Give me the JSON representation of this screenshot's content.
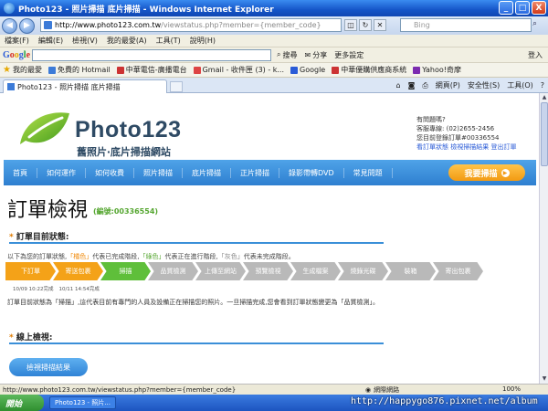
{
  "window": {
    "title": "Photo123 - 照片掃描 底片掃描 - Windows Internet Explorer",
    "minimize": "_",
    "maximize": "□",
    "close": "X"
  },
  "address": {
    "url_host": "http://www.photo123.com.tw",
    "url_path": "/viewstatus.php?member={member_code}",
    "search_placeholder": "Bing",
    "back": "◀",
    "forward": "▶"
  },
  "menu": [
    "檔案(F)",
    "編輯(E)",
    "檢視(V)",
    "我的最愛(A)",
    "工具(T)",
    "說明(H)"
  ],
  "google_toolbar": {
    "logo": [
      "G",
      "o",
      "o",
      "g",
      "l",
      "e"
    ],
    "search_label": "搜尋",
    "share_label": "分享",
    "more_label": "更多設定",
    "signin_label": "登入"
  },
  "favorites": {
    "label": "我的最愛",
    "items": [
      "免費的 Hotmail",
      "中華電信-廣播電台",
      "Gmail - 收件匣 (3) - k...",
      "Google",
      "中華優購供應商系統",
      "Yahoo!奇摩"
    ]
  },
  "tab": {
    "title": "Photo123 - 照片掃描 底片掃描",
    "commands": [
      "網頁(P)",
      "安全性(S)",
      "工具(O)"
    ]
  },
  "site": {
    "logo_text": "Photo123",
    "logo_sub": "舊照片‧底片掃描網站",
    "contact_lines": [
      "有問題嗎?",
      "客服專線: (02)2655-2456",
      "您目前登錄訂單#00336554"
    ],
    "contact_links": "看訂單狀態 檢視掃描結果 登出訂單",
    "nav": [
      "首頁",
      "如何運作",
      "如何收費",
      "照片掃描",
      "底片掃描",
      "正片掃描",
      "錄影帶轉DVD",
      "常見問題"
    ],
    "cta": "我要掃描"
  },
  "order": {
    "title": "訂單檢視",
    "order_number": "(編號:00336554)",
    "status_heading": "訂單目前狀態:",
    "legend_prefix": "以下為您的訂單狀態,",
    "legend_orange": "「橘色」",
    "legend_mid1": "代表已完成階段,",
    "legend_green": "「綠色」",
    "legend_mid2": "代表正在進行階段,",
    "legend_gray": "「灰色」",
    "legend_end": "代表未完成階段。",
    "steps": [
      {
        "label": "下訂單",
        "state": "done"
      },
      {
        "label": "寄送包裹",
        "state": "done"
      },
      {
        "label": "掃描",
        "state": "current"
      },
      {
        "label": "品質檢測",
        "state": "todo"
      },
      {
        "label": "上傳至網站",
        "state": "todo"
      },
      {
        "label": "預覽檢視",
        "state": "todo"
      },
      {
        "label": "生成檔案",
        "state": "todo"
      },
      {
        "label": "燒錄光碟",
        "state": "todo"
      },
      {
        "label": "裝箱",
        "state": "todo"
      },
      {
        "label": "寄出包裹",
        "state": "todo"
      }
    ],
    "timestamps": [
      "10/09 10:22完成",
      "10/11 14:54完成"
    ],
    "status_desc": "訂單目前狀態為「掃描」,這代表目前有專門的人員及設備正在掃描您的照片。一旦掃描完成,您會看到訂單狀態變更為「品質檢測」。",
    "online_heading": "線上檢視:",
    "view_button": "檢視掃描結果"
  },
  "statusbar": {
    "url": "http://www.photo123.com.tw/viewstatus.php?member={member_code}",
    "zone": "網際網路",
    "zoom": "100%"
  },
  "taskbar": {
    "start": "開始",
    "tasks": [
      "Photo123 - 照片..."
    ],
    "watermark": "http://happygo876.pixnet.net/album"
  }
}
